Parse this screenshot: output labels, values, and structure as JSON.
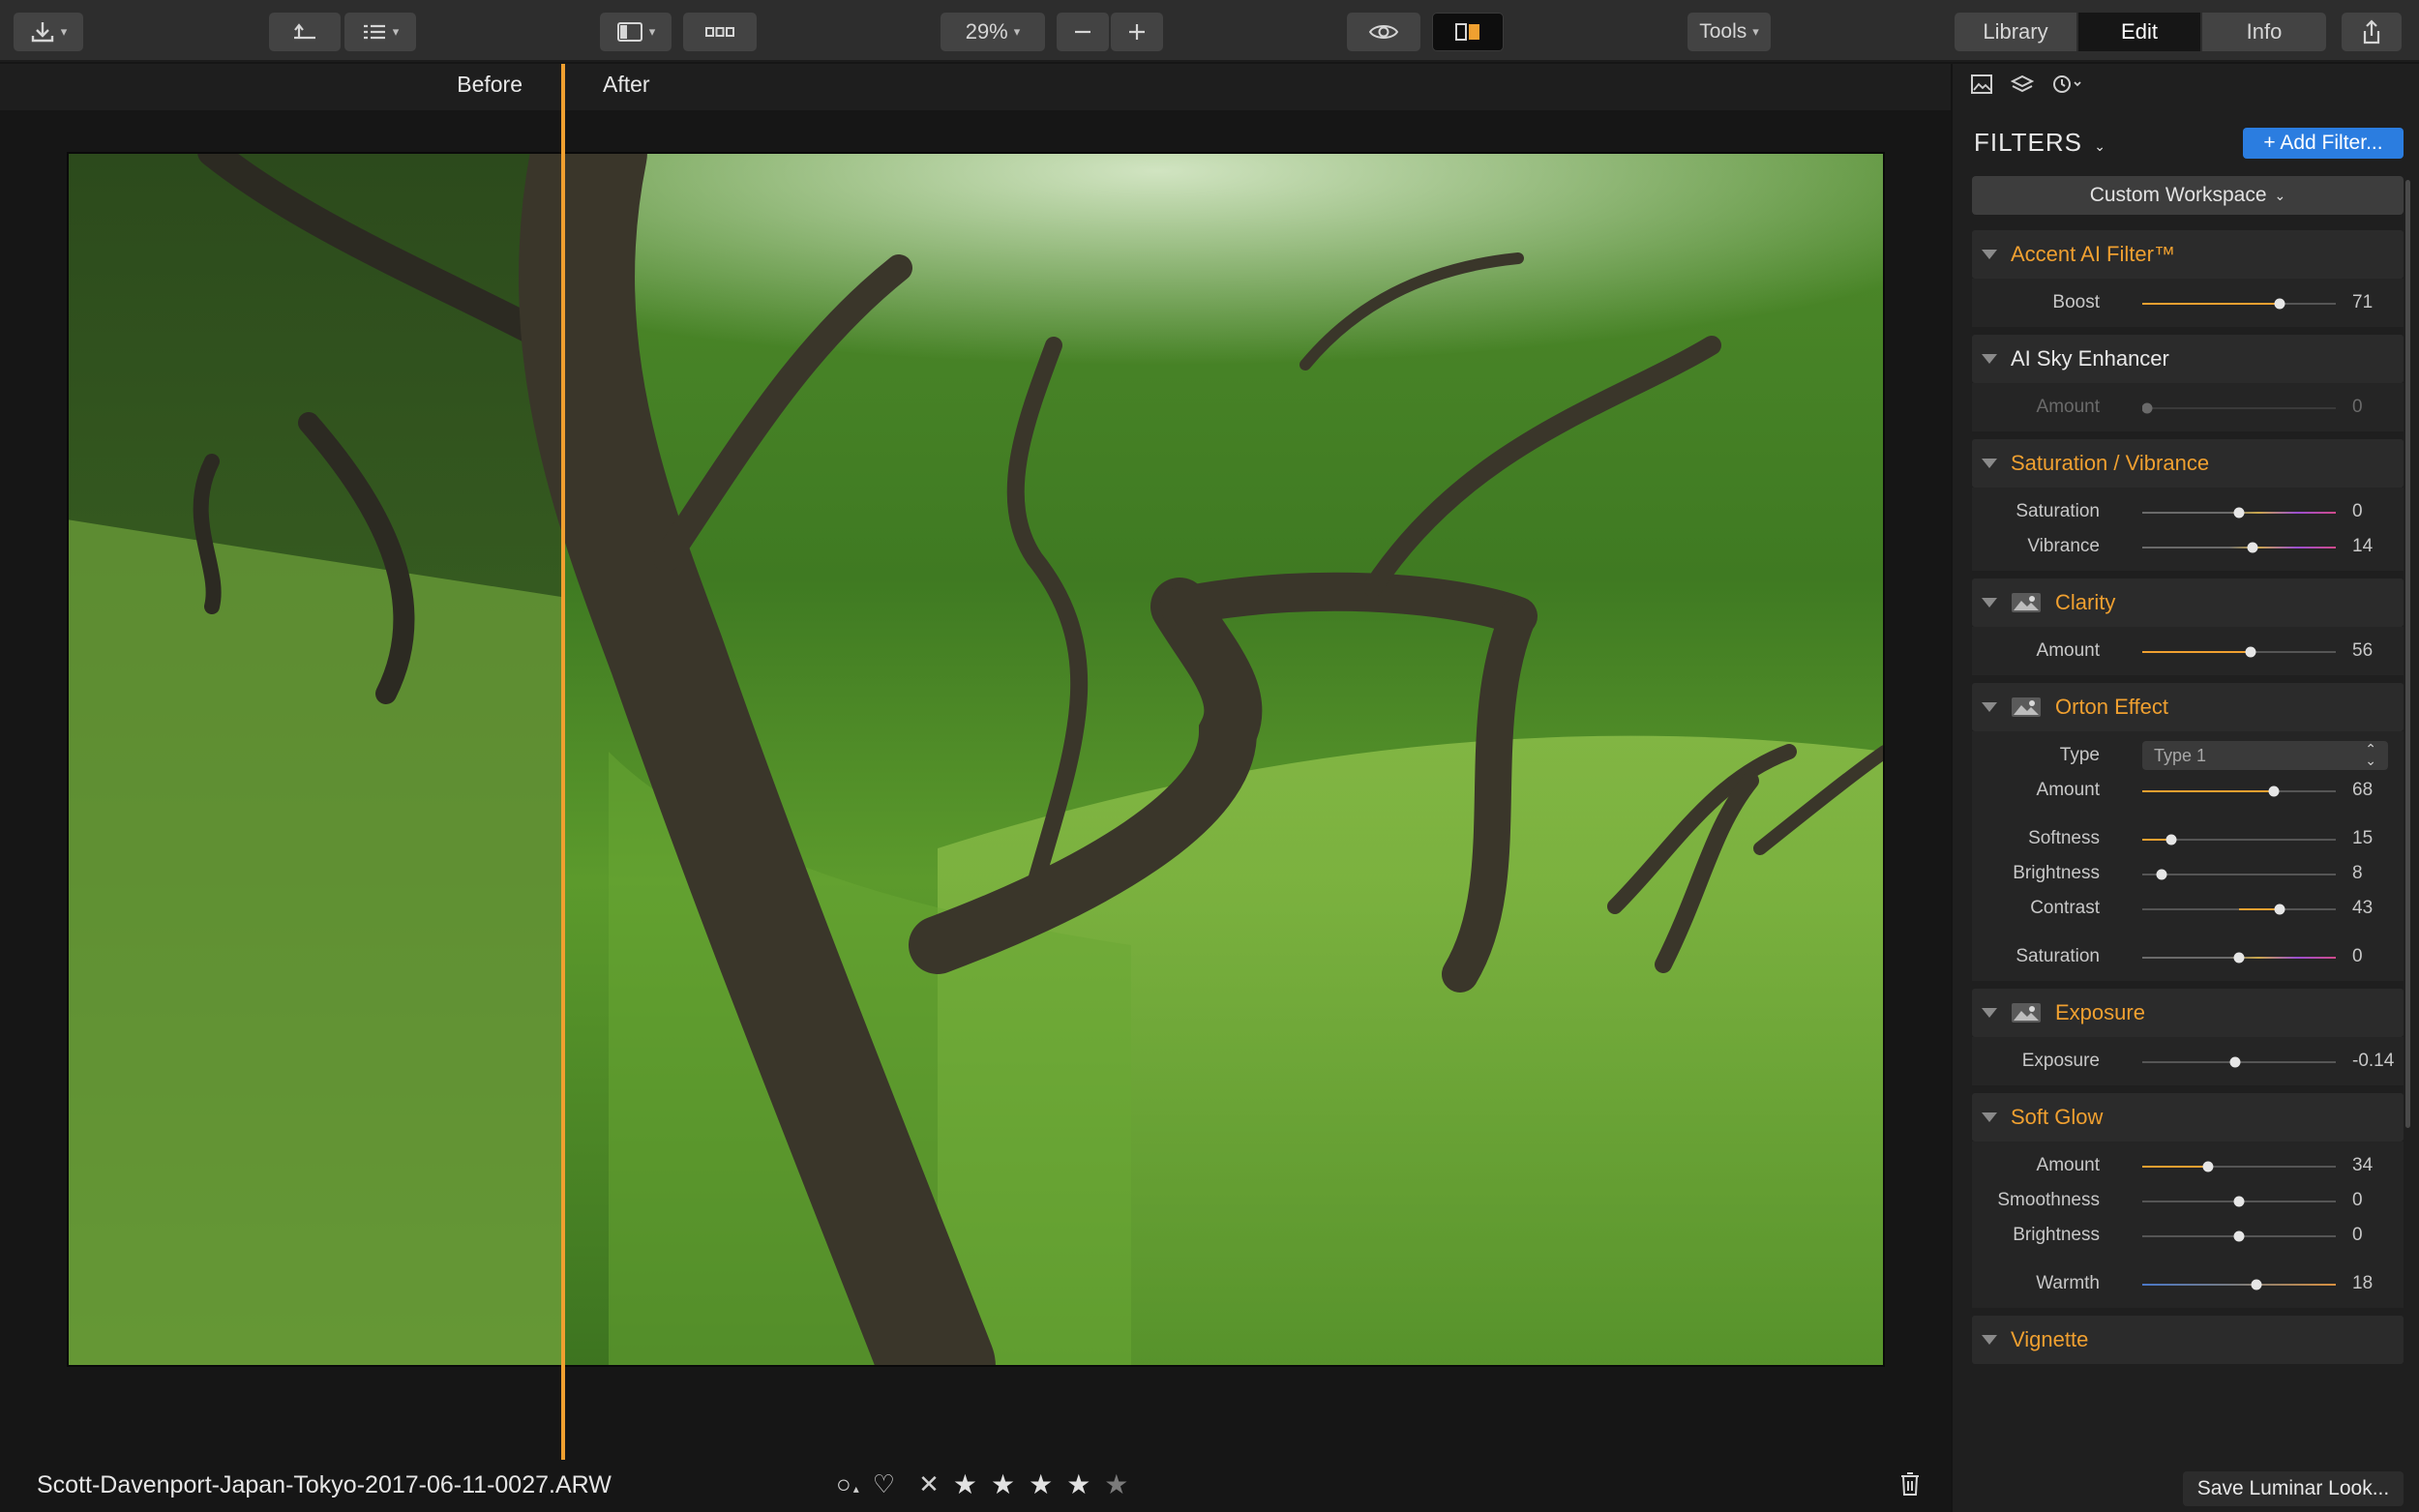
{
  "toolbar": {
    "zoom": "29%",
    "tools_label": "Tools",
    "tabs": [
      {
        "label": "Library",
        "active": false
      },
      {
        "label": "Edit",
        "active": true
      },
      {
        "label": "Info",
        "active": false
      }
    ]
  },
  "viewer": {
    "before_label": "Before",
    "after_label": "After",
    "filename": "Scott-Davenport-Japan-Tokyo-2017-06-11-0027.ARW",
    "rating": 4,
    "rating_max": 5
  },
  "panel": {
    "filters_title": "FILTERS",
    "add_filter_label": "+ Add Filter...",
    "workspace_label": "Custom Workspace",
    "save_look_label": "Save Luminar Look...",
    "filters": [
      {
        "id": "accent",
        "title": "Accent AI Filter™",
        "icon": "",
        "controls": [
          {
            "label": "Boost",
            "value": "71",
            "pos": 0.71,
            "style": "orange"
          }
        ]
      },
      {
        "id": "sky",
        "title": "AI Sky Enhancer",
        "title_white": true,
        "icon": "",
        "controls": [
          {
            "label": "Amount",
            "value": "0",
            "pos": 0.0,
            "style": "dim"
          }
        ]
      },
      {
        "id": "satvib",
        "title": "Saturation / Vibrance",
        "icon": "",
        "controls": [
          {
            "label": "Saturation",
            "value": "0",
            "pos": 0.5,
            "style": "spectrum"
          },
          {
            "label": "Vibrance",
            "value": "14",
            "pos": 0.57,
            "style": "spectrum"
          }
        ]
      },
      {
        "id": "clarity",
        "title": "Clarity",
        "icon": "mask-icon",
        "controls": [
          {
            "label": "Amount",
            "value": "56",
            "pos": 0.56,
            "style": "orange"
          }
        ]
      },
      {
        "id": "orton",
        "title": "Orton Effect",
        "icon": "mask-icon",
        "controls": [
          {
            "label": "Type",
            "select": "Type 1"
          },
          {
            "label": "Amount",
            "value": "68",
            "pos": 0.68,
            "style": "orange"
          },
          {
            "label": "Softness",
            "value": "15",
            "pos": 0.15,
            "style": "orange",
            "gap": true
          },
          {
            "label": "Brightness",
            "value": "8",
            "pos": 0.1,
            "style": "grey"
          },
          {
            "label": "Contrast",
            "value": "43",
            "pos": 0.71,
            "style": "orange-center"
          },
          {
            "label": "Saturation",
            "value": "0",
            "pos": 0.5,
            "style": "spectrum",
            "gap": true
          }
        ]
      },
      {
        "id": "exposure",
        "title": "Exposure",
        "icon": "mask-icon",
        "controls": [
          {
            "label": "Exposure",
            "value": "-0.14",
            "pos": 0.48,
            "style": "grey"
          }
        ]
      },
      {
        "id": "softglow",
        "title": "Soft Glow",
        "icon": "",
        "controls": [
          {
            "label": "Amount",
            "value": "34",
            "pos": 0.34,
            "style": "orange"
          },
          {
            "label": "Smoothness",
            "value": "0",
            "pos": 0.5,
            "style": "grey"
          },
          {
            "label": "Brightness",
            "value": "0",
            "pos": 0.5,
            "style": "grey"
          },
          {
            "label": "Warmth",
            "value": "18",
            "pos": 0.59,
            "style": "warmth",
            "gap": true
          }
        ]
      },
      {
        "id": "vignette",
        "title": "Vignette",
        "icon": "",
        "controls": []
      }
    ]
  },
  "colors": {
    "accent_orange": "#f0a030",
    "accent_blue": "#2b7de0",
    "panel_bg": "#1f1f1f"
  }
}
